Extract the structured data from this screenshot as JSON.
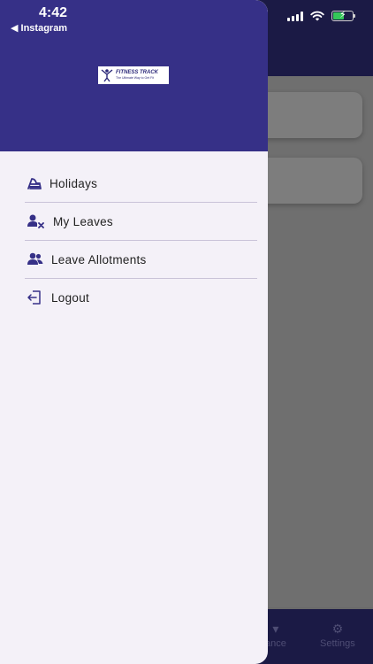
{
  "status_bar": {
    "time": "4:42",
    "back_app": "◀ Instagram"
  },
  "drawer": {
    "logo": {
      "name": "FITNESS TRACK",
      "tagline": "The Ultimate Way to Get Fit"
    },
    "menu": [
      {
        "label": "Holidays",
        "icon": "beach-chair-icon"
      },
      {
        "label": "My Leaves",
        "icon": "user-remove-icon"
      },
      {
        "label": "Leave Allotments",
        "icon": "users-icon"
      },
      {
        "label": "Logout",
        "icon": "logout-icon"
      }
    ]
  },
  "background": {
    "tabs": [
      {
        "label": "ance",
        "icon": "chart-icon"
      },
      {
        "label": "Settings",
        "icon": "gear-icon"
      }
    ]
  },
  "colors": {
    "drawer_header": "#363087",
    "drawer_body": "#f4f1f8",
    "icon": "#363087",
    "app_bar": "#1b1a45"
  }
}
